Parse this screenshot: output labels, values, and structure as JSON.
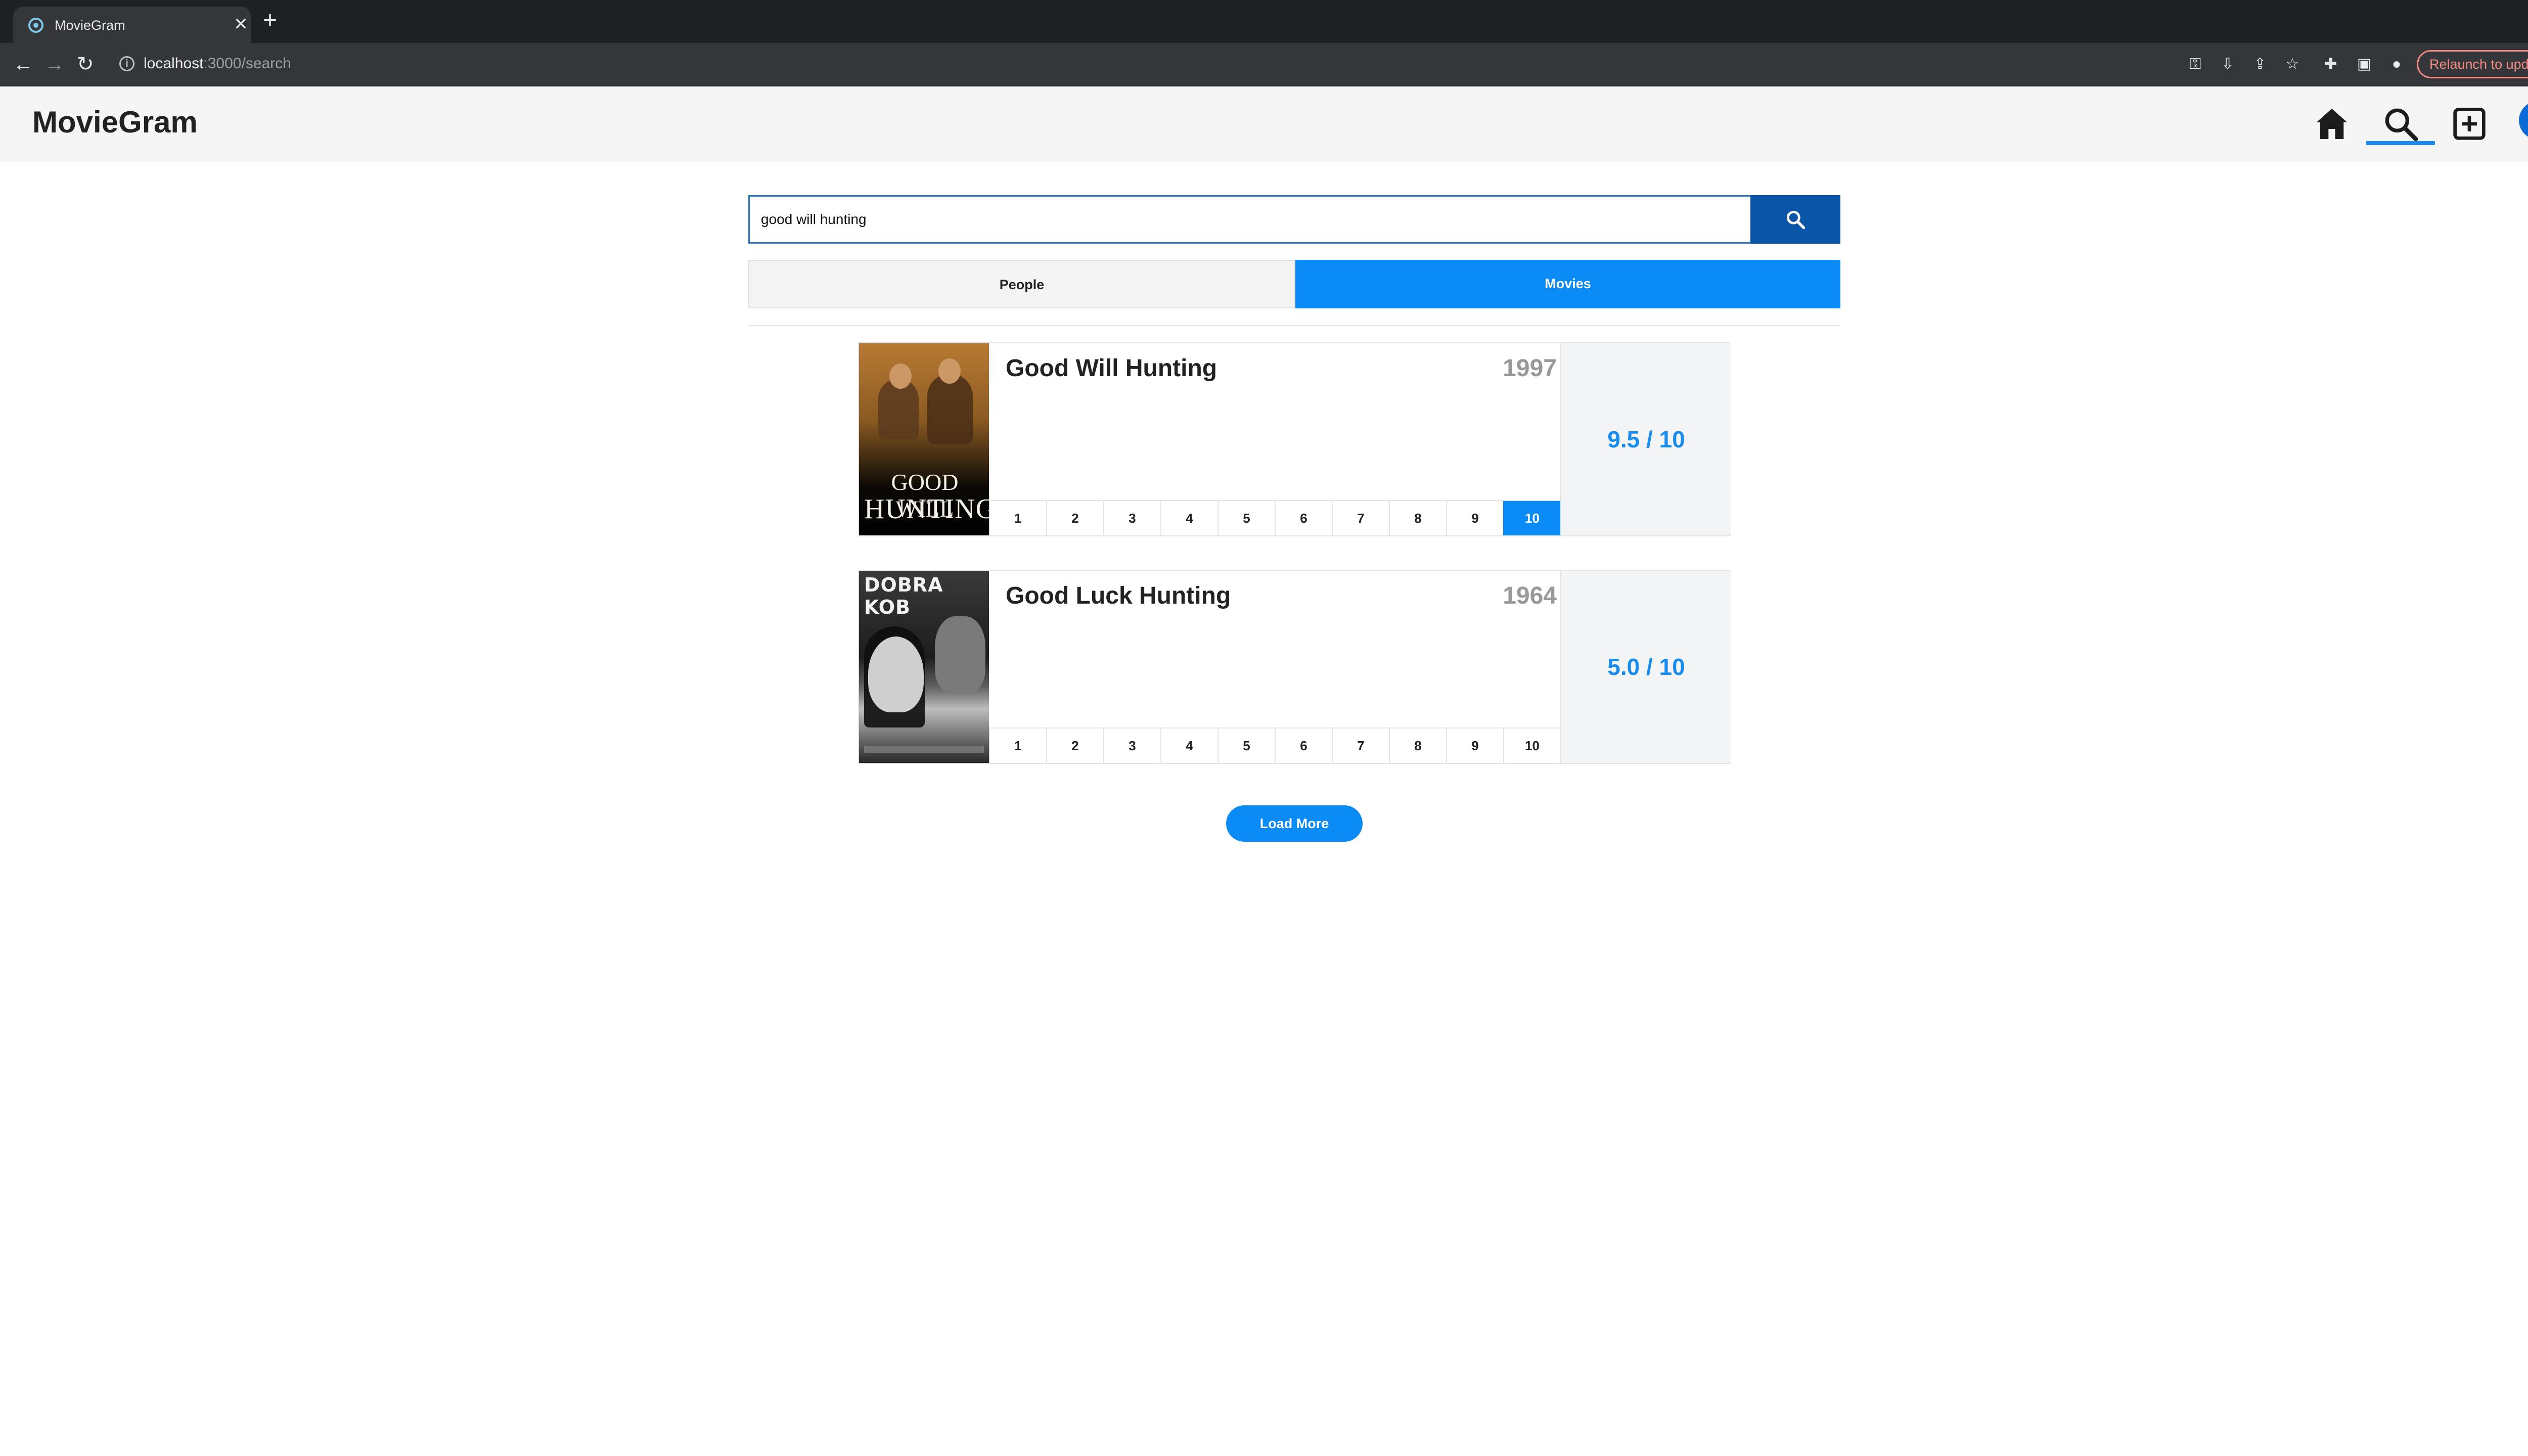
{
  "browser": {
    "tab_title": "MovieGram",
    "tab_close": "✕",
    "new_tab": "+",
    "url_host": "localhost",
    "url_path": ":3000/search",
    "relaunch_label": "Relaunch to update",
    "relaunch_menu": "⋮",
    "tab_menu": "⌄"
  },
  "app": {
    "brand": "MovieGram",
    "nav": [
      "home-icon",
      "search-icon",
      "add-box-icon",
      "avatar"
    ],
    "accent": "#0a8bf5"
  },
  "search": {
    "value": "good will hunting",
    "button_icon": "search-icon"
  },
  "tabs": {
    "people": "People",
    "movies": "Movies",
    "active": "Movies"
  },
  "results": [
    {
      "title": "Good Will Hunting",
      "year": "1997",
      "score": "9.5 / 10",
      "ratings": [
        "1",
        "2",
        "3",
        "4",
        "5",
        "6",
        "7",
        "8",
        "9",
        "10"
      ],
      "selected_rating": 10,
      "poster_line1": "GOOD WILL",
      "poster_line2": "HUNTING"
    },
    {
      "title": "Good Luck Hunting",
      "year": "1964",
      "score": "5.0 / 10",
      "ratings": [
        "1",
        "2",
        "3",
        "4",
        "5",
        "6",
        "7",
        "8",
        "9",
        "10"
      ],
      "selected_rating": null,
      "poster_line1": "DOBRA KOB"
    }
  ],
  "load_more": "Load More"
}
